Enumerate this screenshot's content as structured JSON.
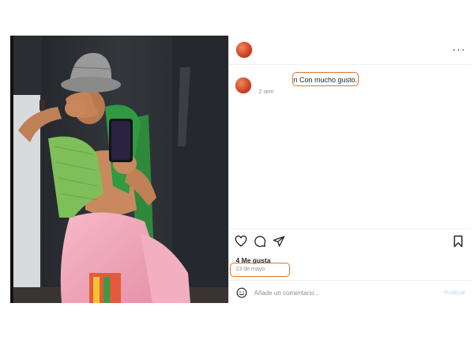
{
  "post": {
    "comment": {
      "text": "n Con mucho gusto.",
      "time": "2 sem"
    },
    "header": {
      "more_label": "···"
    },
    "likes": "4 Me gusta",
    "date": "23 de mayo",
    "add_comment": {
      "placeholder": "Añade un comentario...",
      "publish_label": "Publicar"
    }
  },
  "icons": {
    "more": "more-options-icon",
    "like": "heart-icon",
    "comment": "comment-bubble-icon",
    "share": "send-icon",
    "save": "bookmark-icon",
    "emoji": "emoji-icon"
  },
  "colors": {
    "highlight": "#d9772b",
    "muted_text": "#8e8e8e",
    "publish": "#b3dbff",
    "avatar": "#d2452a"
  }
}
